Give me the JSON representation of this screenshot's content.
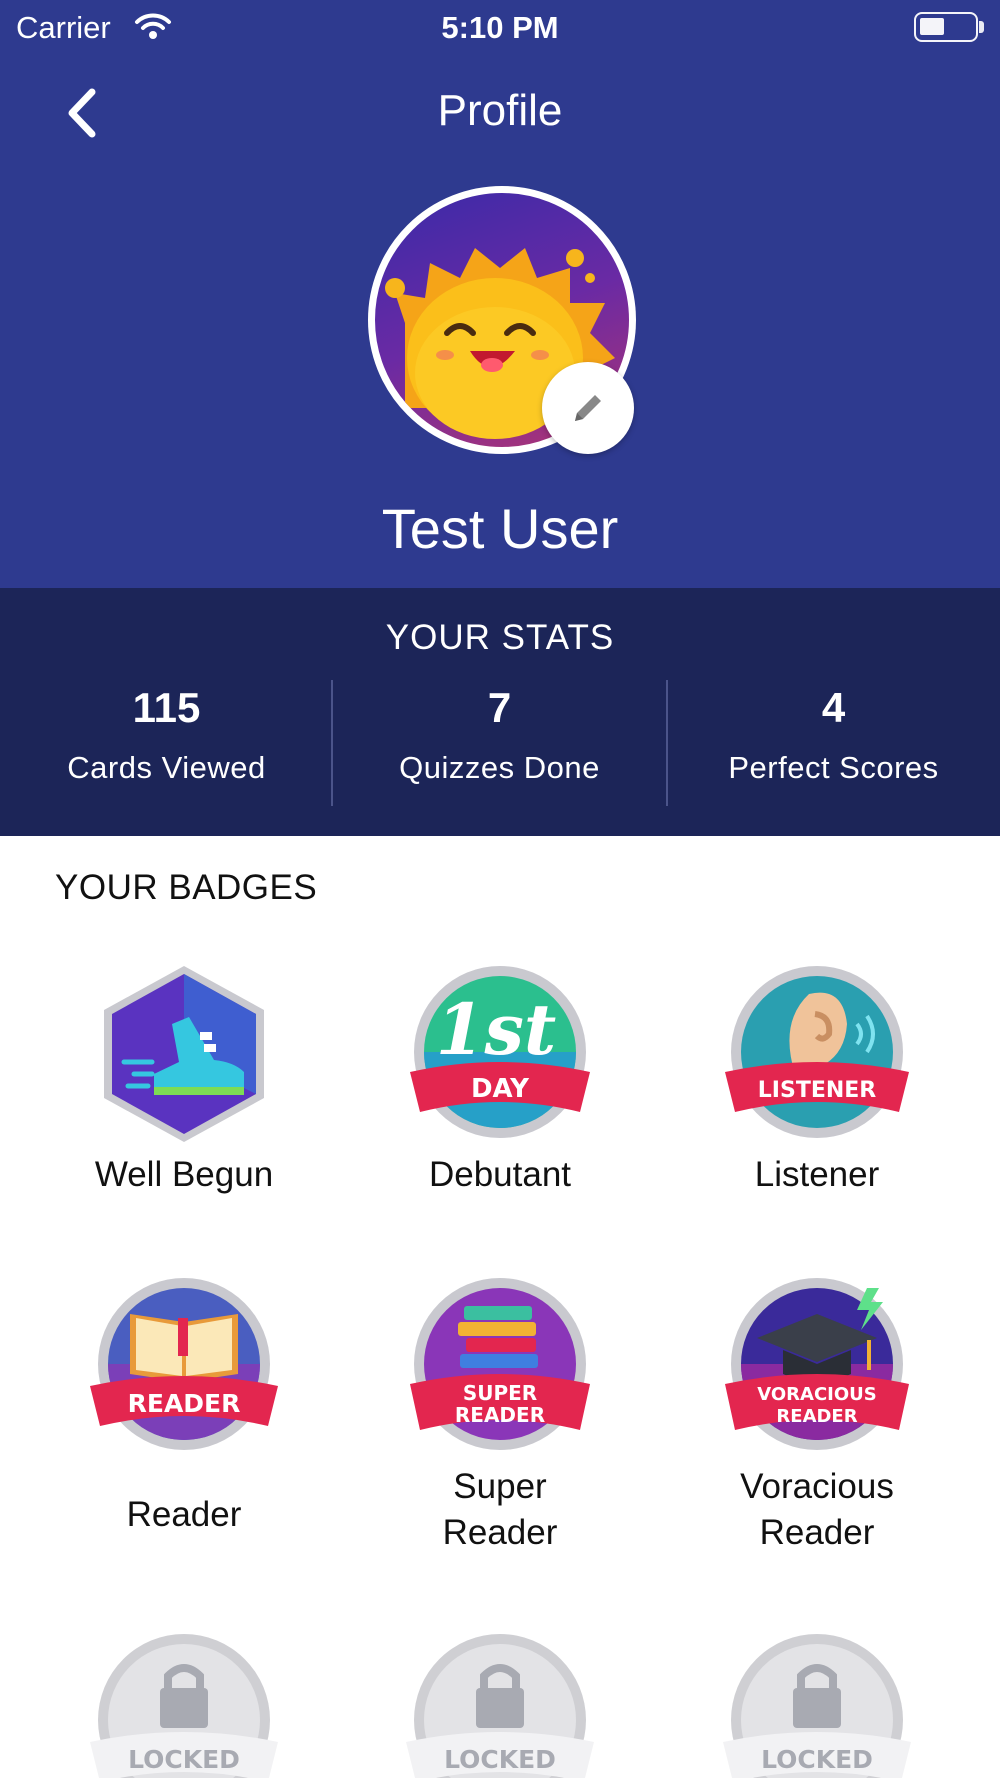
{
  "status_bar": {
    "carrier": "Carrier",
    "time": "5:10 PM"
  },
  "nav": {
    "title": "Profile"
  },
  "profile": {
    "name": "Test User"
  },
  "stats": {
    "title": "YOUR STATS",
    "items": [
      {
        "value": "115",
        "label": "Cards Viewed"
      },
      {
        "value": "7",
        "label": "Quizzes Done"
      },
      {
        "value": "4",
        "label": "Perfect Scores"
      }
    ]
  },
  "badges": {
    "title": "YOUR BADGES",
    "items": [
      {
        "label": "Well Begun",
        "icon": "sneaker-badge-icon"
      },
      {
        "label": "Debutant",
        "icon": "first-day-badge-icon",
        "ribbon": "DAY",
        "mark": "1st"
      },
      {
        "label": "Listener",
        "icon": "ear-badge-icon",
        "ribbon": "LISTENER"
      },
      {
        "label": "Reader",
        "icon": "book-badge-icon",
        "ribbon": "READER"
      },
      {
        "label": "Super\nReader",
        "icon": "books-stack-badge-icon",
        "ribbon_line1": "SUPER",
        "ribbon_line2": "READER"
      },
      {
        "label": "Voracious\nReader",
        "icon": "graduation-cap-badge-icon",
        "ribbon_line1": "VORACIOUS",
        "ribbon_line2": "READER"
      },
      {
        "label": "",
        "icon": "lock-badge-icon",
        "ribbon": "LOCKED"
      },
      {
        "label": "",
        "icon": "lock-badge-icon",
        "ribbon": "LOCKED"
      },
      {
        "label": "",
        "icon": "lock-badge-icon",
        "ribbon": "LOCKED"
      }
    ]
  },
  "colors": {
    "header": "#2e3a8f",
    "stats": "#1c2558",
    "ribbon": "#e3264f"
  }
}
